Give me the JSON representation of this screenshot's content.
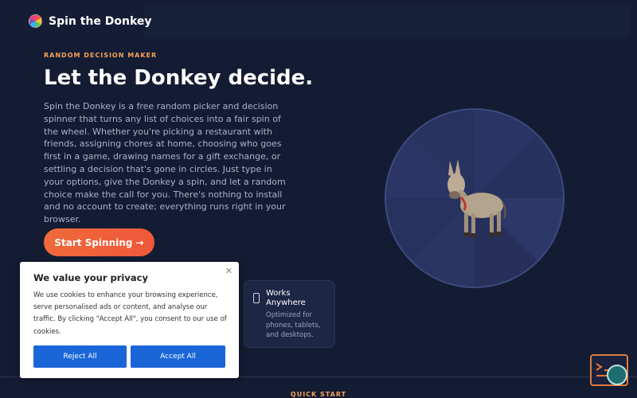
{
  "brand": {
    "name": "Spin the Donkey",
    "logo_icon": "spinner-wheel-icon"
  },
  "hero": {
    "eyebrow": "RANDOM DECISION MAKER",
    "title": "Let the Donkey decide.",
    "description": "Spin the Donkey is a free random picker and decision spinner that turns any list of choices into a fair spin of the wheel. Whether you're picking a restaurant with friends, assigning chores at home, choosing who goes first in a game, drawing names for a gift exchange, or settling a decision that's gone in circles. Just type in your options, give the Donkey a spin, and let a random choice make the call for you. There's nothing to install and no account to create; everything runs right in your browser.",
    "cta_label": "Start Spinning →"
  },
  "feature": {
    "icon": "phone-icon",
    "title": "Works Anywhere",
    "description": "Optimized for phones, tablets, and desktops."
  },
  "wheel": {
    "center_icon": "donkey-icon"
  },
  "section": {
    "quick_start": "QUICK START"
  },
  "cookie": {
    "title": "We value your privacy",
    "text": "We use cookies to enhance your browsing experience, serve personalised ads or content, and analyse our traffic. By clicking \"Accept All\", you consent to our use of cookies.",
    "close_icon": "close-icon",
    "reject_label": "Reject All",
    "accept_label": "Accept All"
  },
  "colors": {
    "accent": "#f5a25a",
    "cta": "#ef5f3a",
    "cookie_button": "#1a66d8",
    "background": "#141c33"
  }
}
